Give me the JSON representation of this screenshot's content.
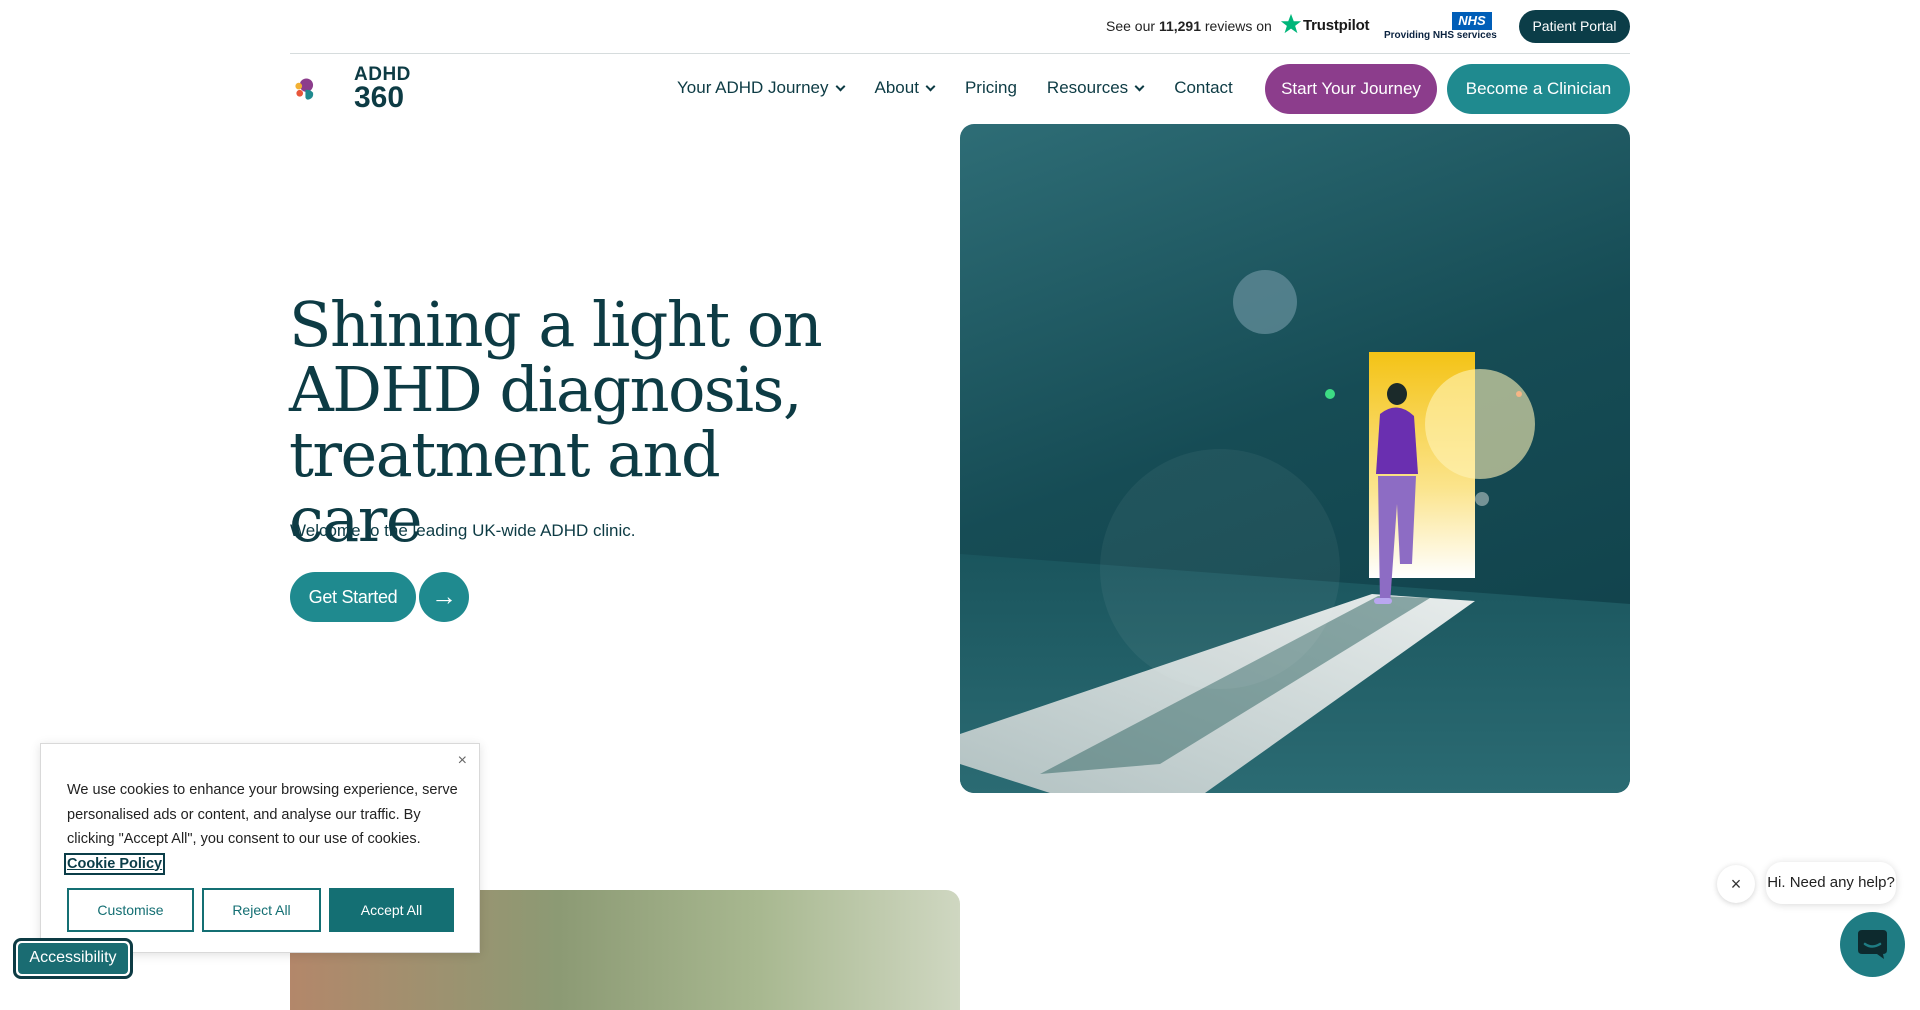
{
  "topbar": {
    "reviews_prefix": "See our",
    "reviews_count": "11,291",
    "reviews_suffix": "reviews on",
    "trustpilot": "Trustpilot",
    "nhs_logo": "NHS",
    "nhs_caption": "Providing NHS services",
    "patient_portal": "Patient Portal"
  },
  "logo": {
    "line1": "ADHD",
    "line2": "360"
  },
  "nav": {
    "items": [
      {
        "label": "Your ADHD Journey",
        "dropdown": true
      },
      {
        "label": "About",
        "dropdown": true
      },
      {
        "label": "Pricing",
        "dropdown": false
      },
      {
        "label": "Resources",
        "dropdown": true
      },
      {
        "label": "Contact",
        "dropdown": false
      }
    ],
    "start_journey": "Start Your Journey",
    "become_clinician": "Become a Clinician"
  },
  "hero": {
    "title": "Shining a light on ADHD diagnosis, treatment and care",
    "subtitle": "Welcome to the leading UK-wide ADHD clinic.",
    "cta": "Get Started",
    "cta_arrow": "→"
  },
  "cookie": {
    "text": "We use cookies to enhance your browsing experience, serve personalised ads or content, and analyse our traffic. By clicking \"Accept All\", you consent to our use of cookies.",
    "policy_link": "Cookie Policy",
    "close": "×",
    "customise": "Customise",
    "reject": "Reject All",
    "accept": "Accept All"
  },
  "accessibility": {
    "label": "Accessibility"
  },
  "chat": {
    "prompt": "Hi. Need any help?",
    "close": "×"
  },
  "colors": {
    "brand_dark": "#0d3b44",
    "teal": "#1f8a8f",
    "purple": "#8c3d8c",
    "portal": "#0b3d48"
  }
}
